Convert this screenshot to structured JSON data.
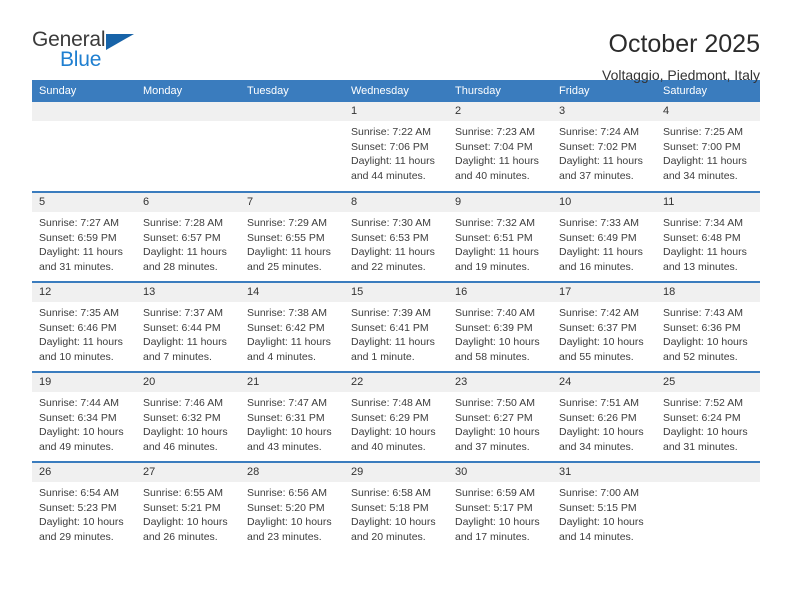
{
  "brand": {
    "name_part1": "General",
    "name_part2": "Blue",
    "flag_icon": "triangle-flag-icon"
  },
  "header": {
    "title": "October 2025",
    "subtitle": "Voltaggio, Piedmont, Italy"
  },
  "calendar": {
    "weekday_headers": [
      "Sunday",
      "Monday",
      "Tuesday",
      "Wednesday",
      "Thursday",
      "Friday",
      "Saturday"
    ],
    "colors": {
      "header_blue": "#3a7cbe",
      "daynum_gray": "#f0f0f0",
      "brand_blue": "#1f7fd0",
      "flag_blue": "#1763a8",
      "text": "#333333"
    },
    "weeks": [
      [
        {
          "day": "",
          "empty": true
        },
        {
          "day": "",
          "empty": true
        },
        {
          "day": "",
          "empty": true
        },
        {
          "day": "1",
          "sunrise": "Sunrise: 7:22 AM",
          "sunset": "Sunset: 7:06 PM",
          "daylight": "Daylight: 11 hours and 44 minutes."
        },
        {
          "day": "2",
          "sunrise": "Sunrise: 7:23 AM",
          "sunset": "Sunset: 7:04 PM",
          "daylight": "Daylight: 11 hours and 40 minutes."
        },
        {
          "day": "3",
          "sunrise": "Sunrise: 7:24 AM",
          "sunset": "Sunset: 7:02 PM",
          "daylight": "Daylight: 11 hours and 37 minutes."
        },
        {
          "day": "4",
          "sunrise": "Sunrise: 7:25 AM",
          "sunset": "Sunset: 7:00 PM",
          "daylight": "Daylight: 11 hours and 34 minutes."
        }
      ],
      [
        {
          "day": "5",
          "sunrise": "Sunrise: 7:27 AM",
          "sunset": "Sunset: 6:59 PM",
          "daylight": "Daylight: 11 hours and 31 minutes."
        },
        {
          "day": "6",
          "sunrise": "Sunrise: 7:28 AM",
          "sunset": "Sunset: 6:57 PM",
          "daylight": "Daylight: 11 hours and 28 minutes."
        },
        {
          "day": "7",
          "sunrise": "Sunrise: 7:29 AM",
          "sunset": "Sunset: 6:55 PM",
          "daylight": "Daylight: 11 hours and 25 minutes."
        },
        {
          "day": "8",
          "sunrise": "Sunrise: 7:30 AM",
          "sunset": "Sunset: 6:53 PM",
          "daylight": "Daylight: 11 hours and 22 minutes."
        },
        {
          "day": "9",
          "sunrise": "Sunrise: 7:32 AM",
          "sunset": "Sunset: 6:51 PM",
          "daylight": "Daylight: 11 hours and 19 minutes."
        },
        {
          "day": "10",
          "sunrise": "Sunrise: 7:33 AM",
          "sunset": "Sunset: 6:49 PM",
          "daylight": "Daylight: 11 hours and 16 minutes."
        },
        {
          "day": "11",
          "sunrise": "Sunrise: 7:34 AM",
          "sunset": "Sunset: 6:48 PM",
          "daylight": "Daylight: 11 hours and 13 minutes."
        }
      ],
      [
        {
          "day": "12",
          "sunrise": "Sunrise: 7:35 AM",
          "sunset": "Sunset: 6:46 PM",
          "daylight": "Daylight: 11 hours and 10 minutes."
        },
        {
          "day": "13",
          "sunrise": "Sunrise: 7:37 AM",
          "sunset": "Sunset: 6:44 PM",
          "daylight": "Daylight: 11 hours and 7 minutes."
        },
        {
          "day": "14",
          "sunrise": "Sunrise: 7:38 AM",
          "sunset": "Sunset: 6:42 PM",
          "daylight": "Daylight: 11 hours and 4 minutes."
        },
        {
          "day": "15",
          "sunrise": "Sunrise: 7:39 AM",
          "sunset": "Sunset: 6:41 PM",
          "daylight": "Daylight: 11 hours and 1 minute."
        },
        {
          "day": "16",
          "sunrise": "Sunrise: 7:40 AM",
          "sunset": "Sunset: 6:39 PM",
          "daylight": "Daylight: 10 hours and 58 minutes."
        },
        {
          "day": "17",
          "sunrise": "Sunrise: 7:42 AM",
          "sunset": "Sunset: 6:37 PM",
          "daylight": "Daylight: 10 hours and 55 minutes."
        },
        {
          "day": "18",
          "sunrise": "Sunrise: 7:43 AM",
          "sunset": "Sunset: 6:36 PM",
          "daylight": "Daylight: 10 hours and 52 minutes."
        }
      ],
      [
        {
          "day": "19",
          "sunrise": "Sunrise: 7:44 AM",
          "sunset": "Sunset: 6:34 PM",
          "daylight": "Daylight: 10 hours and 49 minutes."
        },
        {
          "day": "20",
          "sunrise": "Sunrise: 7:46 AM",
          "sunset": "Sunset: 6:32 PM",
          "daylight": "Daylight: 10 hours and 46 minutes."
        },
        {
          "day": "21",
          "sunrise": "Sunrise: 7:47 AM",
          "sunset": "Sunset: 6:31 PM",
          "daylight": "Daylight: 10 hours and 43 minutes."
        },
        {
          "day": "22",
          "sunrise": "Sunrise: 7:48 AM",
          "sunset": "Sunset: 6:29 PM",
          "daylight": "Daylight: 10 hours and 40 minutes."
        },
        {
          "day": "23",
          "sunrise": "Sunrise: 7:50 AM",
          "sunset": "Sunset: 6:27 PM",
          "daylight": "Daylight: 10 hours and 37 minutes."
        },
        {
          "day": "24",
          "sunrise": "Sunrise: 7:51 AM",
          "sunset": "Sunset: 6:26 PM",
          "daylight": "Daylight: 10 hours and 34 minutes."
        },
        {
          "day": "25",
          "sunrise": "Sunrise: 7:52 AM",
          "sunset": "Sunset: 6:24 PM",
          "daylight": "Daylight: 10 hours and 31 minutes."
        }
      ],
      [
        {
          "day": "26",
          "sunrise": "Sunrise: 6:54 AM",
          "sunset": "Sunset: 5:23 PM",
          "daylight": "Daylight: 10 hours and 29 minutes."
        },
        {
          "day": "27",
          "sunrise": "Sunrise: 6:55 AM",
          "sunset": "Sunset: 5:21 PM",
          "daylight": "Daylight: 10 hours and 26 minutes."
        },
        {
          "day": "28",
          "sunrise": "Sunrise: 6:56 AM",
          "sunset": "Sunset: 5:20 PM",
          "daylight": "Daylight: 10 hours and 23 minutes."
        },
        {
          "day": "29",
          "sunrise": "Sunrise: 6:58 AM",
          "sunset": "Sunset: 5:18 PM",
          "daylight": "Daylight: 10 hours and 20 minutes."
        },
        {
          "day": "30",
          "sunrise": "Sunrise: 6:59 AM",
          "sunset": "Sunset: 5:17 PM",
          "daylight": "Daylight: 10 hours and 17 minutes."
        },
        {
          "day": "31",
          "sunrise": "Sunrise: 7:00 AM",
          "sunset": "Sunset: 5:15 PM",
          "daylight": "Daylight: 10 hours and 14 minutes."
        },
        {
          "day": "",
          "empty": true
        }
      ]
    ]
  }
}
